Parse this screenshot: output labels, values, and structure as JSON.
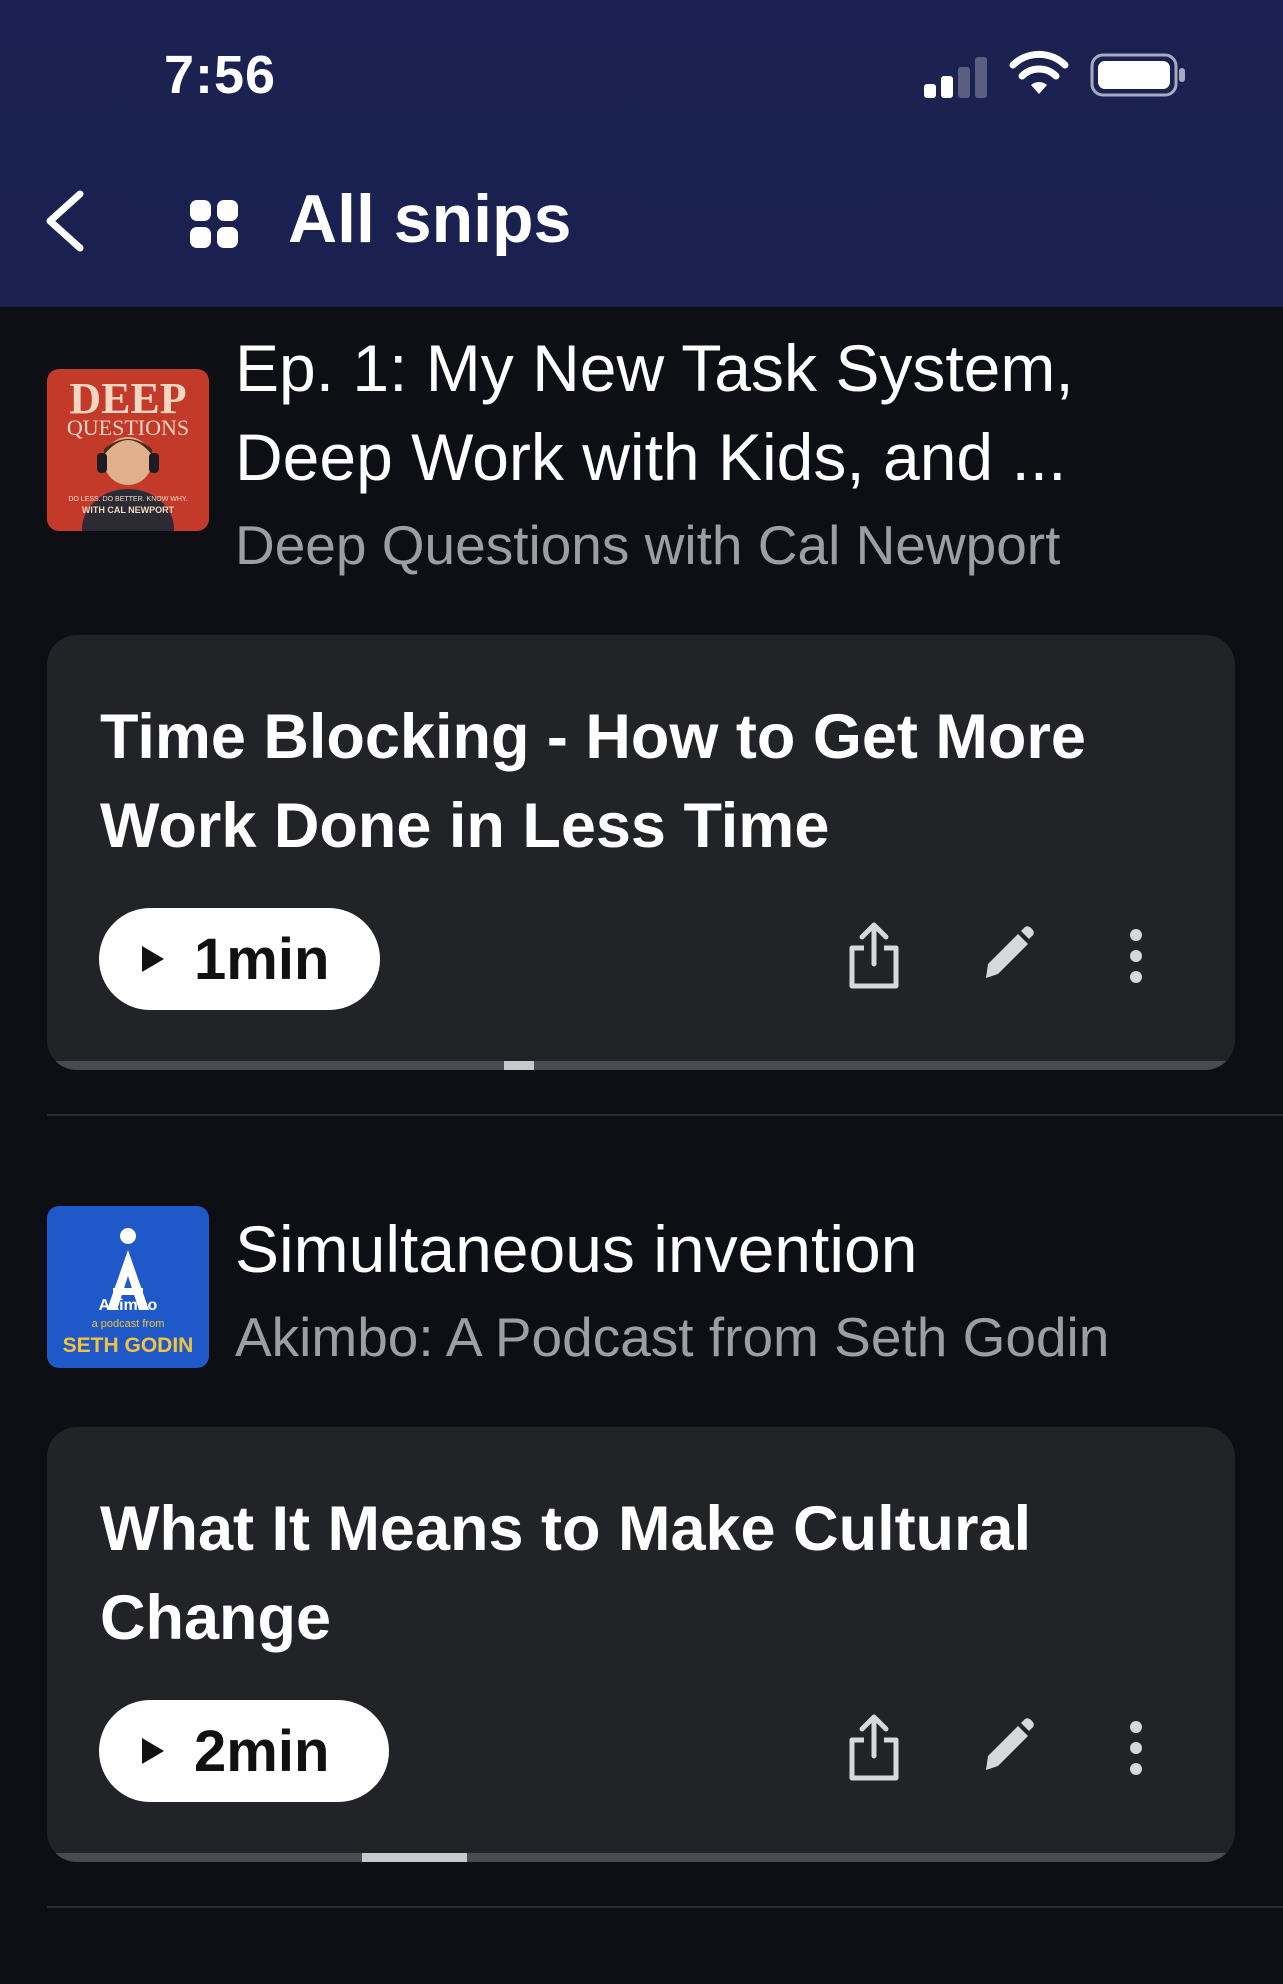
{
  "status_bar": {
    "time": "7:56"
  },
  "header": {
    "title": "All snips",
    "back_icon": "chevron-left-icon",
    "grid_icon": "grid-icon"
  },
  "episodes": [
    {
      "title_line1": "Ep. 1: My New Task System,",
      "title_line2": "Deep Work with Kids, and ...",
      "podcast": "Deep Questions with Cal Newport",
      "art": {
        "brand_line1": "DEEP",
        "brand_line2": "QUESTIONS",
        "tagline": "DO LESS. DO BETTER. KNOW WHY.",
        "host": "WITH CAL NEWPORT",
        "bg": "#c43a2a"
      },
      "snip": {
        "title": "Time Blocking - How to Get More Work Done in Less Time",
        "duration": "1min",
        "progress": 0.385
      }
    },
    {
      "title_line1": "Simultaneous invention",
      "podcast": "Akimbo: A Podcast from Seth Godin",
      "art": {
        "brand": "Akimbo",
        "sub": "a podcast from",
        "host": "SETH GODIN",
        "bg": "#1e58c9"
      },
      "snip": {
        "title": "What It Means to Make Cultural Change",
        "duration": "2min",
        "progress": 0.29
      }
    }
  ],
  "colors": {
    "header_bg": "#1b2253",
    "page_bg": "#0e0f15",
    "card_bg": "#222327",
    "secondary_text": "#9c9ea6"
  }
}
